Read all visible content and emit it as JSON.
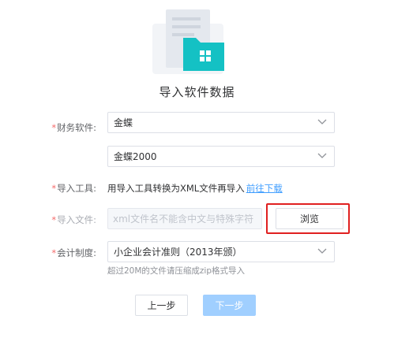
{
  "page": {
    "title": "导入软件数据",
    "icon": "folder-document-illustration-icon"
  },
  "form": {
    "finance_software": {
      "required_mark": "*",
      "label": "财务软件:",
      "value": "金蝶"
    },
    "version": {
      "value": "金蝶2000"
    },
    "import_tool": {
      "required_mark": "*",
      "label": "导入工具:",
      "text": "用导入工具转换为XML文件再导入",
      "link_text": "前往下载"
    },
    "import_file": {
      "required_mark": "*",
      "label": "导入文件:",
      "placeholder": "xml文件名不能含中文与特殊字符",
      "browse_label": "浏览"
    },
    "accounting_system": {
      "required_mark": "*",
      "label": "会计制度:",
      "value": "小企业会计准则（2013年颁）",
      "hint": "超过20M的文件请压缩成zip格式导入"
    }
  },
  "actions": {
    "prev_label": "上一步",
    "next_label": "下一步"
  },
  "colors": {
    "accent": "#409eff",
    "teal": "#14c1c4",
    "required": "#f56c6c",
    "highlight_border": "#e02020",
    "next_disabled": "#a0cfff"
  }
}
